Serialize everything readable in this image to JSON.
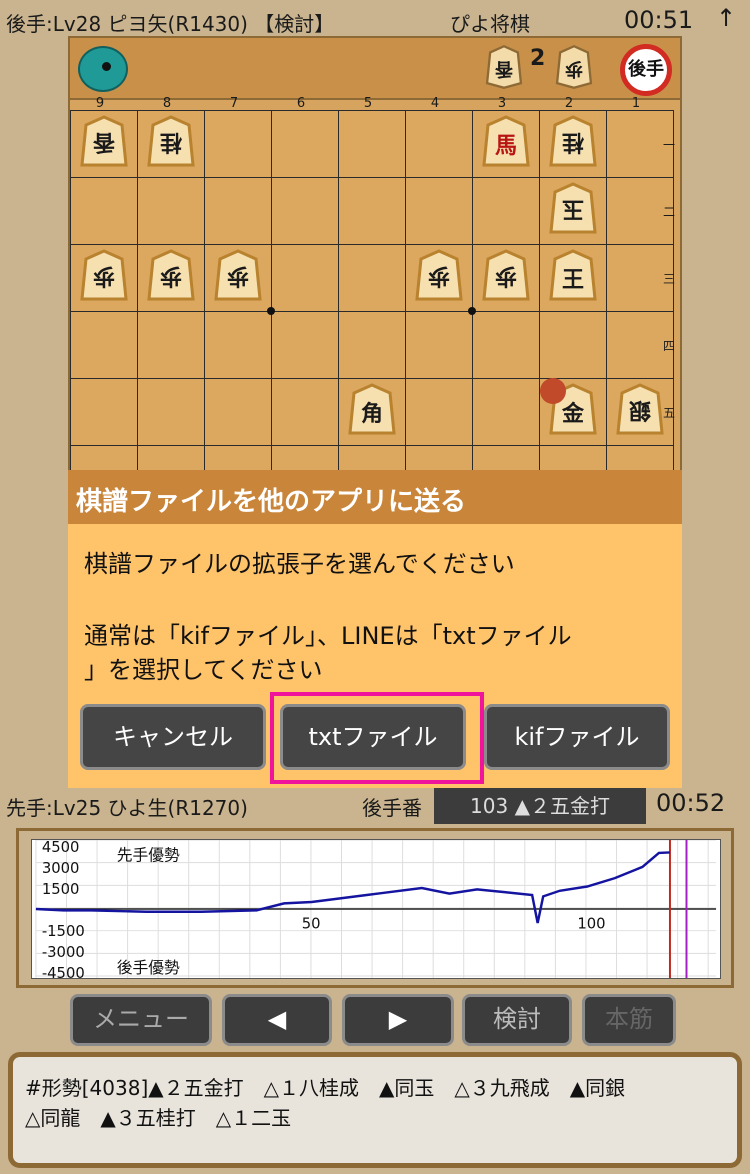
{
  "header": {
    "gote_info": "後手:Lv28 ピヨ矢(R1430) 【検討】",
    "app_title": "ぴよ将棋",
    "gote_clock": "00:51",
    "scroll_up_icon": "↑"
  },
  "board": {
    "gote_hand": {
      "piece": "香",
      "count": "2",
      "piece2": "歩"
    },
    "side_badge": "後手",
    "files": [
      "9",
      "8",
      "7",
      "6",
      "5",
      "4",
      "3",
      "2",
      "1"
    ],
    "ranks": [
      "一",
      "二",
      "三",
      "四",
      "五"
    ],
    "pieces": [
      {
        "id": "p-9-1",
        "kanji": "香",
        "side": "gote"
      },
      {
        "id": "p-8-1",
        "kanji": "桂",
        "side": "gote"
      },
      {
        "id": "p-3-1",
        "kanji": "馬",
        "side": "sente",
        "promoted": true
      },
      {
        "id": "p-2-1",
        "kanji": "桂",
        "side": "gote"
      },
      {
        "id": "p-2-2",
        "kanji": "玉",
        "side": "gote"
      },
      {
        "id": "p-9-3",
        "kanji": "歩",
        "side": "gote"
      },
      {
        "id": "p-8-3",
        "kanji": "歩",
        "side": "gote"
      },
      {
        "id": "p-7-3",
        "kanji": "歩",
        "side": "gote"
      },
      {
        "id": "p-4-3",
        "kanji": "歩",
        "side": "gote"
      },
      {
        "id": "p-3-3",
        "kanji": "歩",
        "side": "gote"
      },
      {
        "id": "p-2-3",
        "kanji": "王",
        "side": "sente"
      },
      {
        "id": "p-5-5",
        "kanji": "角",
        "side": "sente"
      },
      {
        "id": "p-2-5",
        "kanji": "金",
        "side": "sente"
      },
      {
        "id": "p-1-5",
        "kanji": "銀",
        "side": "gote"
      }
    ]
  },
  "dialog": {
    "title": "棋譜ファイルを他のアプリに送る",
    "message_1": "棋譜ファイルの拡張子を選んでください",
    "message_2": "通常は「kifファイル」、LINEは「txtファイル",
    "message_3": "」を選択してください",
    "cancel_label": "キャンセル",
    "txt_label": "txtファイル",
    "kif_label": "kifファイル"
  },
  "status": {
    "sente_info": "先手:Lv25 ひよ生(R1270)",
    "turn_label": "後手番",
    "last_move": "103 ▲２五金打",
    "sente_clock": "00:52"
  },
  "graph": {
    "y_ticks": [
      "4500",
      "3000",
      "1500",
      "-1500",
      "-3000",
      "-4500"
    ],
    "x_ticks": [
      "50",
      "100"
    ],
    "sente_adv_label": "先手優勢",
    "gote_adv_label": "後手優勢",
    "line_color": "#1414a0",
    "marker_colors": [
      "#c0281e",
      "#a020c0"
    ]
  },
  "chart_data": {
    "type": "line",
    "ylim": [
      -4500,
      4500
    ],
    "xlim": [
      0,
      118
    ],
    "series": [
      {
        "values": [
          [
            0,
            0
          ],
          [
            5,
            -100
          ],
          [
            10,
            -100
          ],
          [
            20,
            -200
          ],
          [
            30,
            -200
          ],
          [
            40,
            -100
          ],
          [
            45,
            400
          ],
          [
            50,
            500
          ],
          [
            60,
            1000
          ],
          [
            70,
            1500
          ],
          [
            75,
            1100
          ],
          [
            80,
            1400
          ],
          [
            85,
            1200
          ],
          [
            90,
            1000
          ],
          [
            91,
            -1000
          ],
          [
            92,
            900
          ],
          [
            95,
            1300
          ],
          [
            100,
            1600
          ],
          [
            105,
            2200
          ],
          [
            110,
            3000
          ],
          [
            113,
            4000
          ],
          [
            115,
            4038
          ]
        ]
      }
    ]
  },
  "nav": {
    "menu_label": "メニュー",
    "prev_icon": "◀",
    "next_icon": "▶",
    "study_label": "検討",
    "main_line_label": "本筋"
  },
  "comment": {
    "line_1": "#形勢[4038]▲２五金打　△１八桂成　▲同玉　△３九飛成　▲同銀",
    "line_2": "△同龍　▲３五桂打　△１二玉"
  }
}
